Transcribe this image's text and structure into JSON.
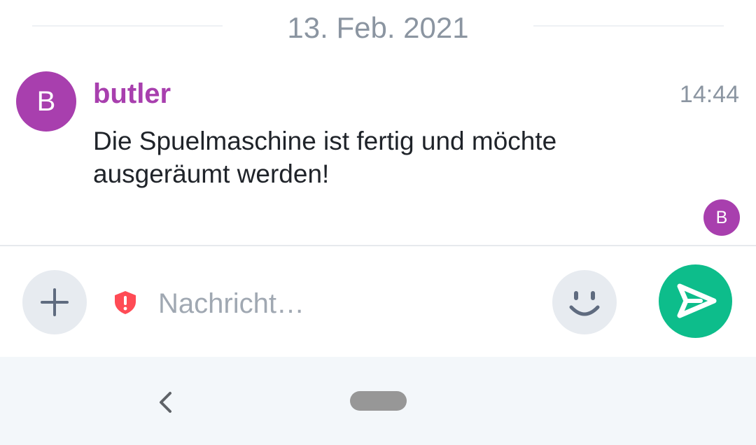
{
  "timeline": {
    "date_separator": "13. Feb. 2021",
    "event": {
      "avatar_letter": "B",
      "avatar_color": "#a83fae",
      "sender": "butler",
      "time": "14:44",
      "body": "Die Spuelmaschine ist fertig und möchte ausgeräumt werden!",
      "read_receipt_letter": "B"
    }
  },
  "composer": {
    "add_icon": "plus-icon",
    "security_icon": "shield-warning-icon",
    "security_color": "#ff4b55",
    "placeholder": "Nachricht…",
    "emoji_icon": "smiley-icon",
    "send_icon": "send-icon",
    "send_color": "#0dbd8b"
  },
  "navbar": {
    "back_icon": "back-chevron-icon",
    "home_icon": "home-pill"
  }
}
